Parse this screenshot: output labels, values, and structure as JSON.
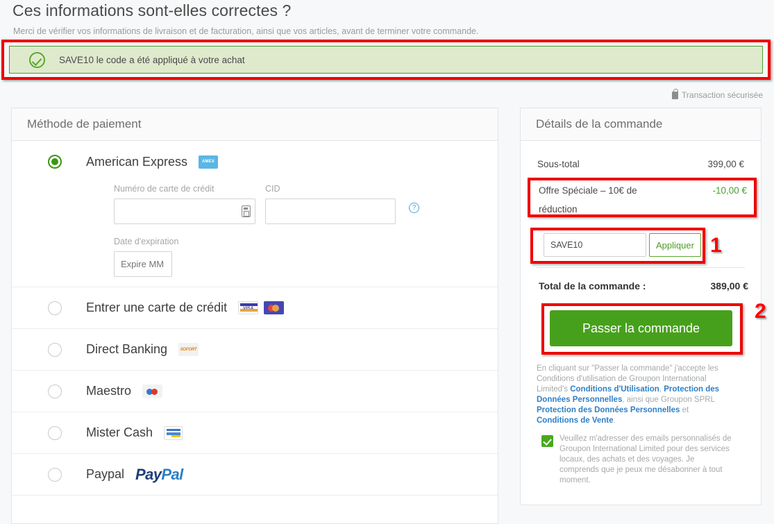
{
  "header": {
    "title": "Ces informations sont-elles correctes ?",
    "subtitle": "Merci de vérifier vos informations de livraison et de facturation, ainsi que vos articles, avant de terminer votre commande."
  },
  "banner": {
    "icon": "check-circle-icon",
    "message": "SAVE10 le code a été appliqué à votre achat"
  },
  "secure": {
    "icon": "lock-icon",
    "label": "Transaction sécurisée"
  },
  "payment": {
    "panel_title": "Méthode de paiement",
    "selected_method": {
      "label": "American Express",
      "logo": "amex-logo",
      "logo_text": "AMEX",
      "fields": {
        "card_number_label": "Numéro de carte de crédit",
        "card_number_value": "",
        "card_number_placeholder": "",
        "cid_label": "CID",
        "cid_value": "",
        "cid_placeholder": "",
        "help_icon": "?",
        "expiry_label": "Date d'expiration",
        "expiry_value": "",
        "expiry_placeholder": "Expire MM"
      }
    },
    "methods": [
      {
        "label": "Entrer une carte de crédit",
        "logos": [
          "visa-logo",
          "mastercard-logo"
        ]
      },
      {
        "label": "Direct Banking",
        "logos": [
          "sofort-logo"
        ],
        "logo_text": "SOFORT"
      },
      {
        "label": "Maestro",
        "logos": [
          "maestro-logo"
        ]
      },
      {
        "label": "Mister Cash",
        "logos": [
          "mistercash-logo"
        ]
      },
      {
        "label": "Paypal",
        "logos": [
          "paypal-logo"
        ],
        "logo_text_1": "Pay",
        "logo_text_2": "Pal"
      }
    ]
  },
  "order": {
    "panel_title": "Détails de la commande",
    "subtotal_label": "Sous-total",
    "subtotal_value": "399,00 €",
    "discount_label": "Offre Spéciale – 10€ de réduction",
    "discount_value": "-10,00 €",
    "coupon_value": "SAVE10",
    "apply_label": "Appliquer",
    "total_label": "Total de la commande :",
    "total_value": "389,00 €",
    "cta_label": "Passer la commande",
    "terms_prefix": "En cliquant sur \"Passer la commande\" j'accepte les Conditions d'utilisation de Groupon International Limited's ",
    "terms_link_1": "Conditions d'Utilisation",
    "terms_sep_1": ", ",
    "terms_link_2": "Protection des Données Personnelles",
    "terms_mid": ", ainsi que Groupon SPRL ",
    "terms_link_3": "Protection des Données Personnelles",
    "terms_and": " et ",
    "terms_link_4": "Conditions de Vente",
    "terms_end": ".",
    "optin_text": "Veuillez m'adresser des emails personnalisés de Groupon International Limited pour des services locaux, des achats et des voyages. Je comprends que je peux me désabonner à tout moment."
  },
  "annotations": {
    "badge_1": "1",
    "badge_2": "2"
  },
  "colors": {
    "accent_green": "#47a01c",
    "annotation_red": "#ef0000",
    "link_blue": "#2e7fc6",
    "banner_bg": "#dfeacd"
  }
}
